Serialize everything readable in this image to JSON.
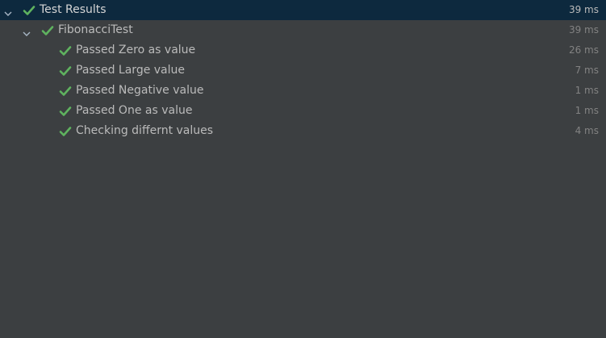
{
  "colors": {
    "background": "#3c3f41",
    "selected_row": "#0d293e",
    "pass_check": "#5fb35f",
    "text": "#bbbbbb",
    "time_text": "#828282"
  },
  "root": {
    "label": "Test Results",
    "time": "39 ms",
    "status_icon": "check-icon",
    "expanded": true
  },
  "suite": {
    "label": "FibonacciTest",
    "time": "39 ms",
    "status_icon": "check-icon",
    "expanded": true
  },
  "tests": [
    {
      "label": "Passed Zero as value",
      "time": "26 ms",
      "status_icon": "check-icon"
    },
    {
      "label": "Passed Large value",
      "time": "7 ms",
      "status_icon": "check-icon"
    },
    {
      "label": "Passed Negative value",
      "time": "1 ms",
      "status_icon": "check-icon"
    },
    {
      "label": "Passed One as value",
      "time": "1 ms",
      "status_icon": "check-icon"
    },
    {
      "label": "Checking differnt values",
      "time": "4 ms",
      "status_icon": "check-icon"
    }
  ]
}
